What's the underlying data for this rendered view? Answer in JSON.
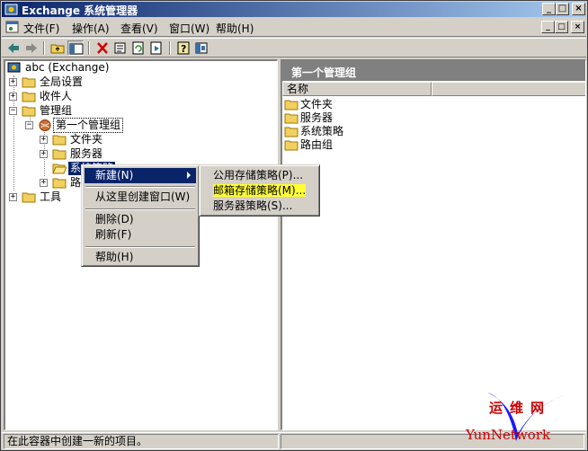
{
  "window": {
    "title": "Exchange 系统管理器",
    "min_glyph": "_",
    "max_glyph": "□",
    "close_glyph": "×"
  },
  "menubar": {
    "items": [
      "文件(F)",
      "操作(A)",
      "查看(V)",
      "窗口(W)",
      "帮助(H)"
    ]
  },
  "toolbar": {
    "icons": [
      "back-arrow-icon",
      "forward-arrow-icon",
      "up-folder-icon",
      "show-tree-icon",
      "delete-icon",
      "properties-icon",
      "refresh-icon",
      "export-list-icon",
      "help-icon",
      "console-icon"
    ]
  },
  "tree": {
    "root": "abc (Exchange)",
    "global_settings": "全局设置",
    "recipients": "收件人",
    "admin_groups": "管理组",
    "first_admin_group": "第一个管理组",
    "folders": "文件夹",
    "servers": "服务器",
    "system_policies": "系统策略",
    "routing": "路",
    "tools": "工具"
  },
  "right_pane": {
    "header": "第一个管理组",
    "column_name": "名称",
    "items": [
      "文件夹",
      "服务器",
      "系统策略",
      "路由组"
    ]
  },
  "context_menu": {
    "new": "新建(N)",
    "new_window": "从这里创建窗口(W)",
    "delete": "删除(D)",
    "refresh": "刷新(F)",
    "help": "帮助(H)"
  },
  "submenu": {
    "public_store_policy": "公用存储策略(P)...",
    "mailbox_store_policy": "邮箱存储策略(M)...",
    "server_policy": "服务器策略(S)..."
  },
  "statusbar": {
    "text": "在此容器中创建一新的项目。"
  },
  "watermark": {
    "cn": "运维网",
    "en": "YunNetwork"
  },
  "colors": {
    "title_start": "#0a246a",
    "title_end": "#a6caf0",
    "selection": "#0a246a",
    "highlight_yellow": "#ffff33",
    "watermark_red": "#cc0000",
    "watermark_blue": "#1a1aff"
  }
}
